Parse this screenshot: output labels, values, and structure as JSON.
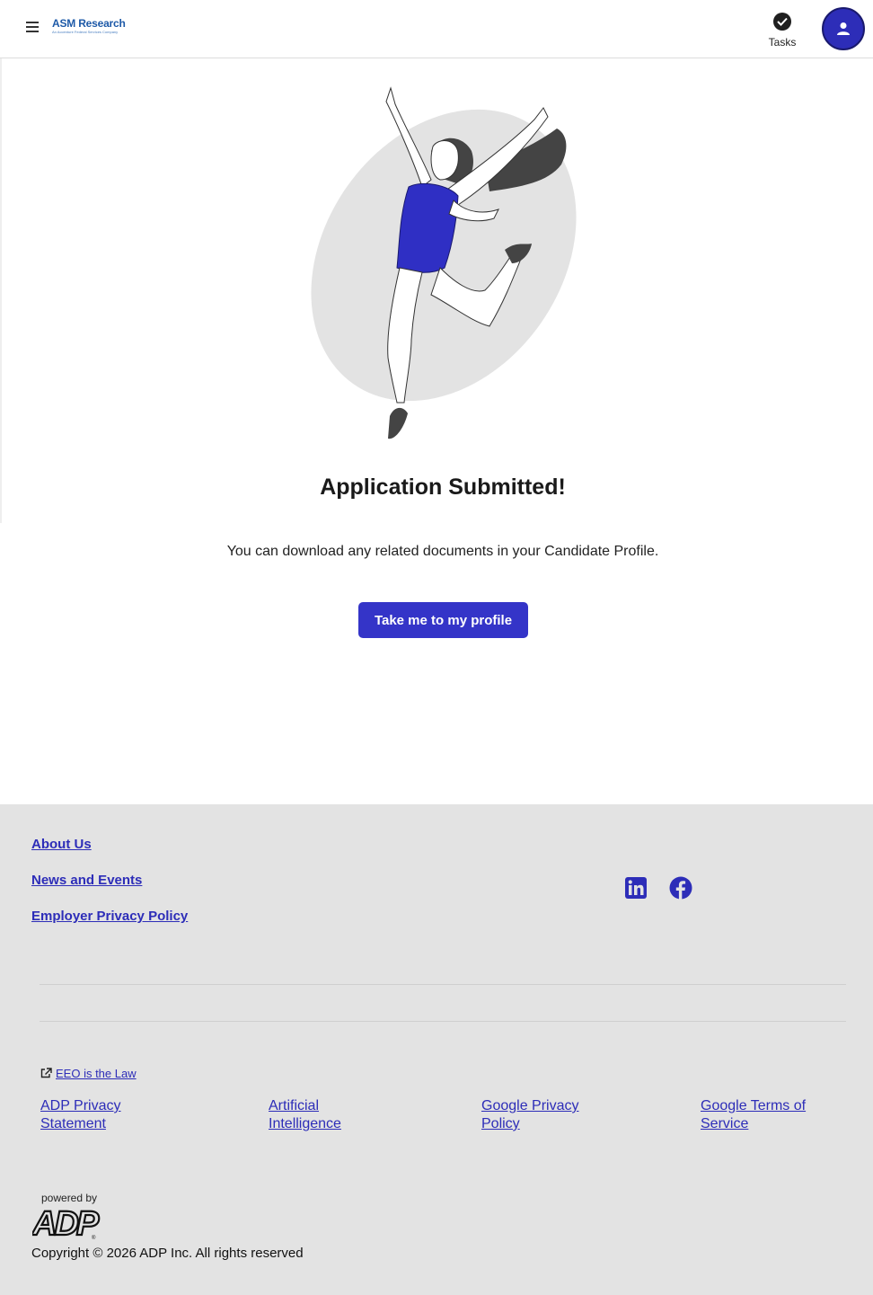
{
  "header": {
    "logo_text": "ASM Research",
    "logo_tagline": "An Accenture Federal Services Company",
    "tasks_label": "Tasks"
  },
  "main": {
    "title": "Application Submitted!",
    "subtitle": "You can download any related documents in your Candidate Profile.",
    "cta_label": "Take me to my profile"
  },
  "footer": {
    "links": [
      "About Us",
      "News and Events",
      "Employer Privacy Policy"
    ],
    "social": [
      "linkedin-icon",
      "facebook-icon"
    ],
    "eeo_label": "EEO is the Law",
    "legal": [
      "ADP Privacy Statement",
      "Artificial Intelligence",
      "Google Privacy Policy",
      "Google Terms of Service"
    ],
    "powered_by": "powered by",
    "adp_logo_text": "ADP",
    "copyright": "Copyright © 2026 ADP Inc. All rights reserved"
  },
  "colors": {
    "accent": "#3434c8",
    "avatar": "#2d2db8",
    "footer_bg": "#e3e3e3",
    "link": "#2d2db8"
  }
}
